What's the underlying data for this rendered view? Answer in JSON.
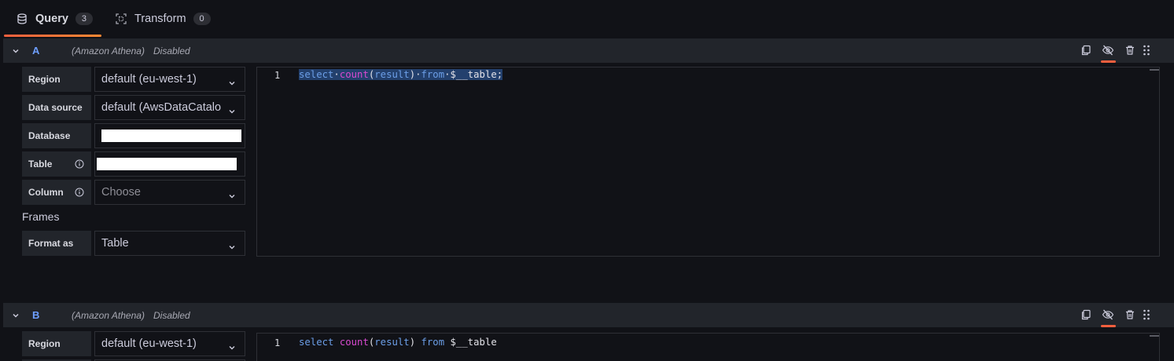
{
  "tabs": [
    {
      "label": "Query",
      "count": "3"
    },
    {
      "label": "Transform",
      "count": "0"
    }
  ],
  "queries": [
    {
      "ref_id": "A",
      "datasource": "(Amazon Athena)",
      "state": "Disabled",
      "fields": {
        "region_label": "Region",
        "region_value": "default (eu-west-1)",
        "datasource_label": "Data source",
        "datasource_value": "default (AwsDataCatalo",
        "database_label": "Database",
        "table_label": "Table",
        "column_label": "Column",
        "column_placeholder": "Choose",
        "frames_heading": "Frames",
        "format_label": "Format as",
        "format_value": "Table"
      },
      "editor": {
        "line_number": "1",
        "code_tokens": {
          "select": "select",
          "count": "count",
          "open": "(",
          "arg": "result",
          "close": ")",
          "from": "from",
          "table": "$__table;"
        }
      }
    },
    {
      "ref_id": "B",
      "datasource": "(Amazon Athena)",
      "state": "Disabled",
      "fields": {
        "region_label": "Region",
        "region_value": "default (eu-west-1)"
      },
      "editor": {
        "line_number": "1",
        "code_tokens": {
          "select": "select",
          "count": "count",
          "open": "(",
          "arg": "result",
          "close": ")",
          "from": "from",
          "table": "$__table"
        }
      }
    }
  ],
  "icons": {
    "database": "database-icon",
    "transform": "transform-icon",
    "collapse": "chevron-down-icon",
    "duplicate": "copy-icon",
    "toggle_visibility": "eye-slash-icon",
    "delete": "trash-icon",
    "drag": "drag-handle-icon",
    "info": "info-circle-icon"
  },
  "colors": {
    "background": "#111217",
    "panel": "#22252b",
    "accent": "#f55f3e",
    "ref_id": "#6e9fff",
    "keyword": "#6c9fe8",
    "function": "#d94ad1",
    "selection": "#23406d"
  }
}
